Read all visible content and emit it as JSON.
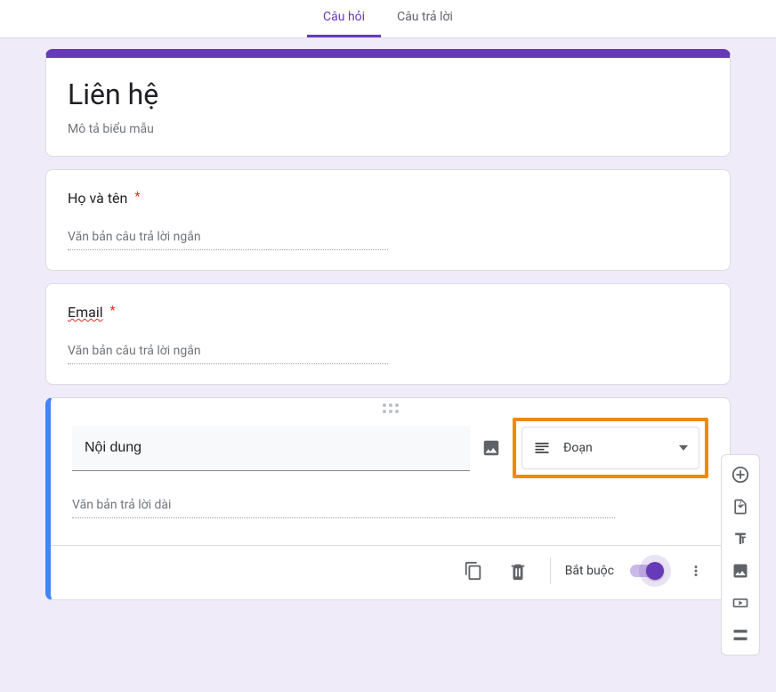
{
  "tabs": {
    "questions": "Câu hỏi",
    "responses": "Câu trả lời"
  },
  "form": {
    "title": "Liên hệ",
    "description": "Mô tả biểu mẫu"
  },
  "q1": {
    "title": "Họ và tên",
    "placeholder": "Văn bản câu trả lời ngắn"
  },
  "q2": {
    "title": "Email",
    "placeholder": "Văn bản câu trả lời ngắn"
  },
  "q3": {
    "title": "Nội dung",
    "type_label": "Đoạn",
    "placeholder": "Văn bản trả lời dài"
  },
  "footer": {
    "required": "Bắt buộc"
  }
}
